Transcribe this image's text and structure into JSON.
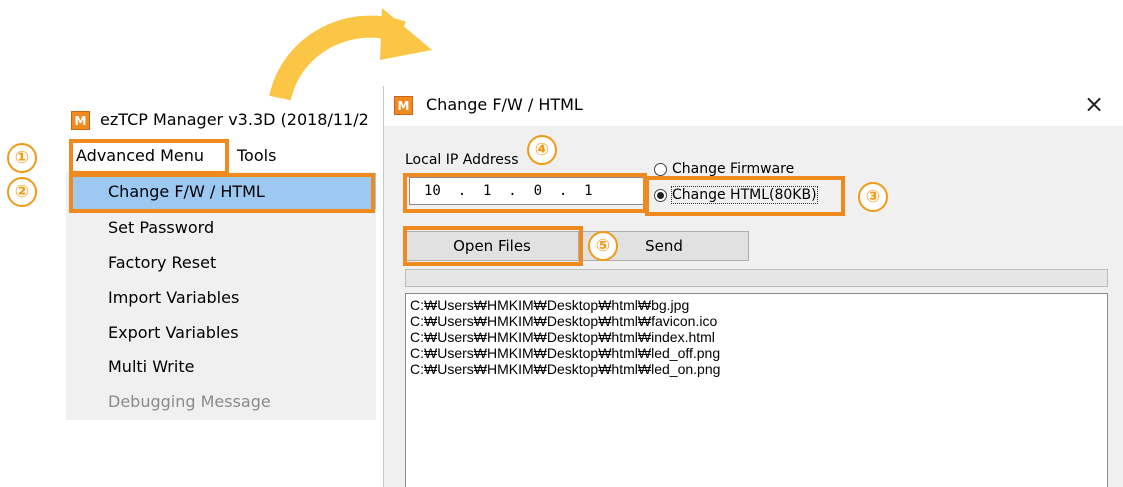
{
  "app": {
    "logo": "M",
    "title": "ezTCP Manager v3.3D (2018/11/2",
    "menubar": [
      "Advanced Menu",
      "Tools"
    ],
    "menu_items": [
      "Change F/W / HTML",
      "Set Password",
      "Factory Reset",
      "Import Variables",
      "Export Variables",
      "Multi Write",
      "Debugging Message"
    ]
  },
  "dialog": {
    "logo": "M",
    "title": "Change F/W / HTML",
    "close": "×",
    "ip_label": "Local IP Address",
    "ip_value": "10  .  1  .  0  .  1",
    "radio_firmware": "Change Firmware",
    "radio_html": "Change HTML(80KB)",
    "selected_radio": "html",
    "open_files_label": "Open Files",
    "send_label": "Send",
    "files": [
      "C:₩Users₩HMKIM₩Desktop₩html₩bg.jpg",
      "C:₩Users₩HMKIM₩Desktop₩html₩favicon.ico",
      "C:₩Users₩HMKIM₩Desktop₩html₩index.html",
      "C:₩Users₩HMKIM₩Desktop₩html₩led_off.png",
      "C:₩Users₩HMKIM₩Desktop₩html₩led_on.png"
    ]
  },
  "callouts": [
    "①",
    "②",
    "③",
    "④",
    "⑤"
  ],
  "colors": {
    "accent_orange": "#ef8a1e",
    "selection_blue": "#9cc8f2",
    "arrow_yellow": "#fbc645"
  }
}
